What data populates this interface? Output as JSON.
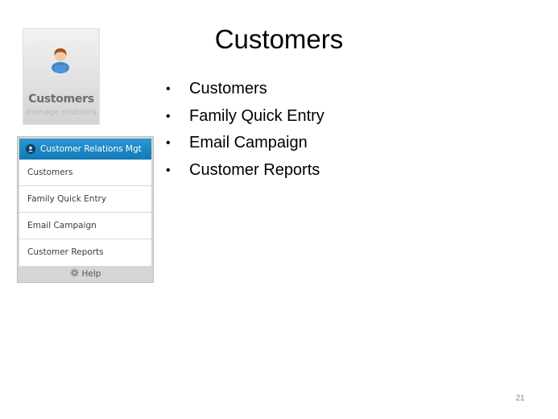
{
  "slide": {
    "title": "Customers",
    "number": "21"
  },
  "tile": {
    "icon": "person-icon",
    "title": "Customers",
    "subtitle": "manage relations"
  },
  "menu": {
    "header_icon": "user-circle-icon",
    "header": "Customer Relations Mgt",
    "items": [
      {
        "label": "Customers"
      },
      {
        "label": "Family Quick Entry"
      },
      {
        "label": "Email Campaign"
      },
      {
        "label": "Customer Reports"
      }
    ],
    "footer_icon": "gear-icon",
    "footer": "Help",
    "accent_color": "#1a87c6"
  },
  "bullets": {
    "marker": "•",
    "items": [
      "Customers",
      "Family Quick Entry",
      "Email Campaign",
      "Customer Reports"
    ]
  }
}
